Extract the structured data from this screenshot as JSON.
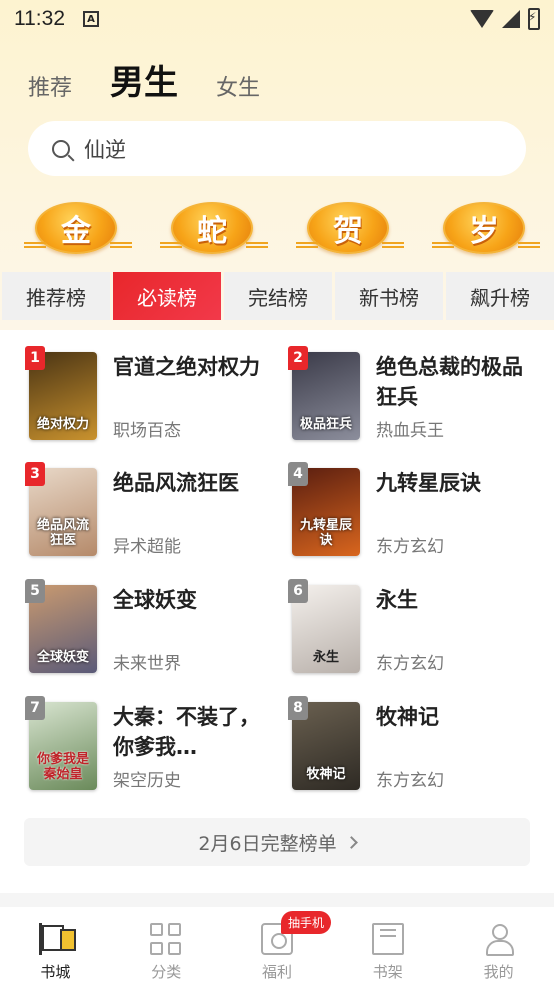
{
  "status_bar": {
    "time": "11:32",
    "notification_icon": "A"
  },
  "gender_tabs": [
    {
      "label": "推荐",
      "active": false
    },
    {
      "label": "男生",
      "active": true
    },
    {
      "label": "女生",
      "active": false
    }
  ],
  "search": {
    "value": "仙逆"
  },
  "festival": [
    "金",
    "蛇",
    "贺",
    "岁"
  ],
  "rank_tabs": [
    {
      "label": "推荐榜",
      "active": false
    },
    {
      "label": "必读榜",
      "active": true
    },
    {
      "label": "完结榜",
      "active": false
    },
    {
      "label": "新书榜",
      "active": false
    },
    {
      "label": "飙升榜",
      "active": false
    }
  ],
  "books": [
    {
      "rank": "1",
      "title": "官道之绝对权力",
      "category": "职场百态",
      "cover_text": "绝对权力",
      "cover_colors": [
        "#4a3414",
        "#c9922e"
      ]
    },
    {
      "rank": "2",
      "title": "绝色总裁的极品狂兵",
      "category": "热血兵王",
      "cover_text": "极品狂兵",
      "cover_colors": [
        "#3a3a48",
        "#8c8e9c"
      ]
    },
    {
      "rank": "3",
      "title": "绝品风流狂医",
      "category": "异术超能",
      "cover_text": "绝品风流狂医",
      "cover_colors": [
        "#e8d8c8",
        "#b58a6a"
      ]
    },
    {
      "rank": "4",
      "title": "九转星辰诀",
      "category": "东方玄幻",
      "cover_text": "九转星辰诀",
      "cover_colors": [
        "#5a1e10",
        "#d9661e"
      ]
    },
    {
      "rank": "5",
      "title": "全球妖变",
      "category": "未来世界",
      "cover_text": "全球妖变",
      "cover_colors": [
        "#c99a70",
        "#5a5a78"
      ]
    },
    {
      "rank": "6",
      "title": "永生",
      "category": "东方玄幻",
      "cover_text": "永生",
      "cover_colors": [
        "#f4f0ec",
        "#b8b0aa"
      ]
    },
    {
      "rank": "7",
      "title": "大秦：不装了，你爹我…",
      "category": "架空历史",
      "cover_text": "你爹我是秦始皇",
      "cover_colors": [
        "#d8e4d0",
        "#6a8a5a"
      ]
    },
    {
      "rank": "8",
      "title": "牧神记",
      "category": "东方玄幻",
      "cover_text": "牧神记",
      "cover_colors": [
        "#6a6050",
        "#2e2a24"
      ]
    }
  ],
  "full_list": {
    "label": "2月6日完整榜单"
  },
  "bottom_nav": [
    {
      "label": "书城",
      "icon": "bookstore-flag-icon",
      "active": true
    },
    {
      "label": "分类",
      "icon": "category-grid-icon",
      "active": false
    },
    {
      "label": "福利",
      "icon": "gift-icon",
      "active": false,
      "badge": "抽手机"
    },
    {
      "label": "书架",
      "icon": "bookshelf-icon",
      "active": false
    },
    {
      "label": "我的",
      "icon": "profile-icon",
      "active": false
    }
  ],
  "colors": {
    "accent": "#e8272b",
    "header_bg": "#fdf3d0"
  }
}
